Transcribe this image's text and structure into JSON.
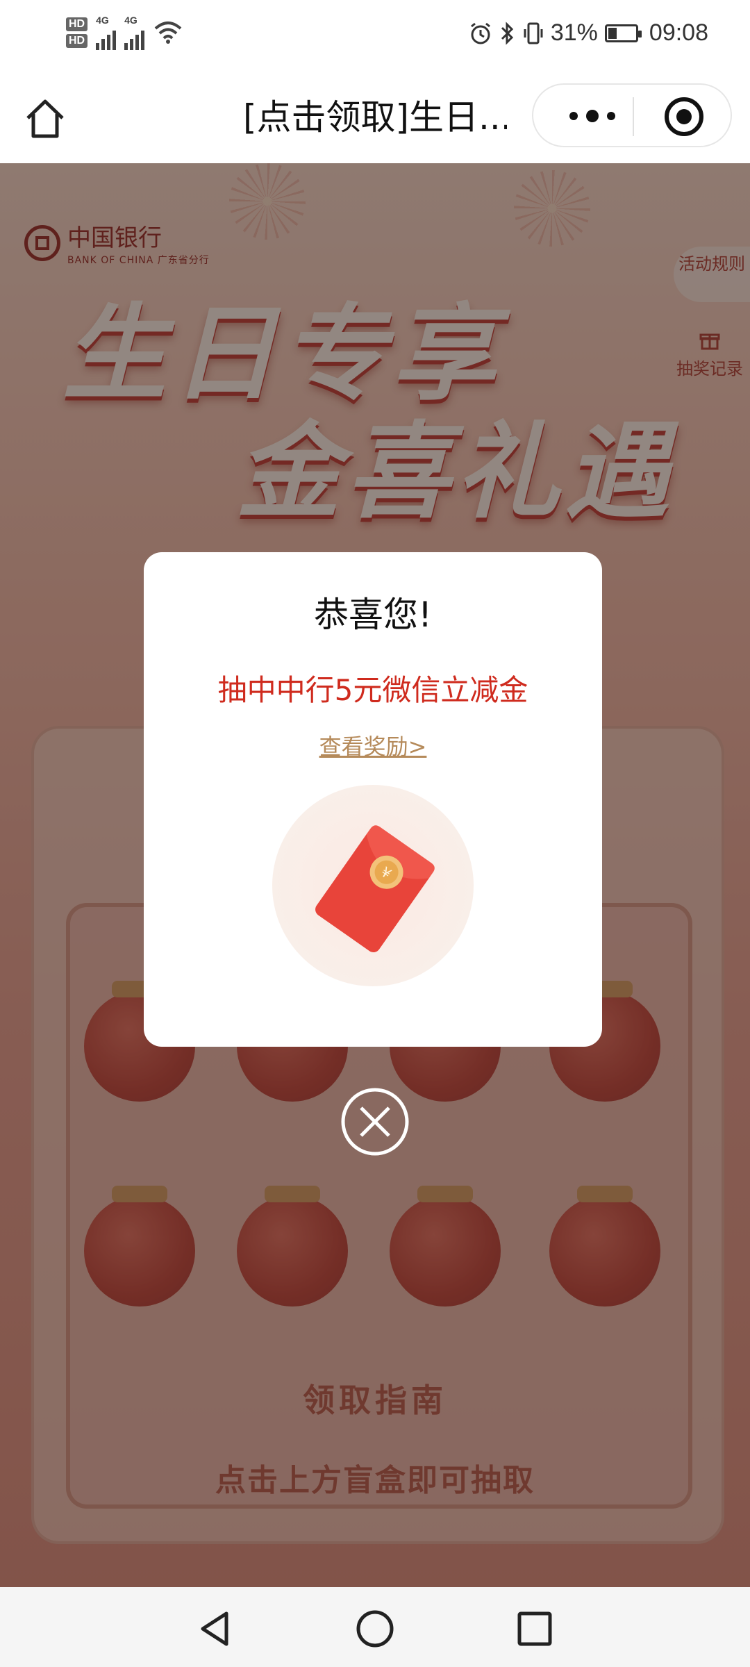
{
  "status_bar": {
    "time": "09:08",
    "battery_percent": "31%",
    "battery_level": 0.31,
    "sim1_label": "HD",
    "sim2_label": "HD",
    "network1": "4G",
    "network2": "4G"
  },
  "nav": {
    "title": "[点击领取]生日..."
  },
  "background": {
    "bank_name_cn": "中国银行",
    "bank_name_en": "BANK OF CHINA",
    "branch": "广东省分行",
    "rules_button": "活动规则",
    "record_link": "抽奖记录",
    "hero_line1": "生日专享",
    "hero_line2": "金喜礼遇",
    "guide_title": "领取指南",
    "guide_text": "点击上方盲盒即可抽取"
  },
  "modal": {
    "title": "恭喜您!",
    "prize": "抽中中行5元微信立减金",
    "view_link": "查看奖励>"
  },
  "colors": {
    "prize_red": "#cf2b1e",
    "link_gold": "#b58a5a",
    "envelope_red": "#e8443a"
  }
}
